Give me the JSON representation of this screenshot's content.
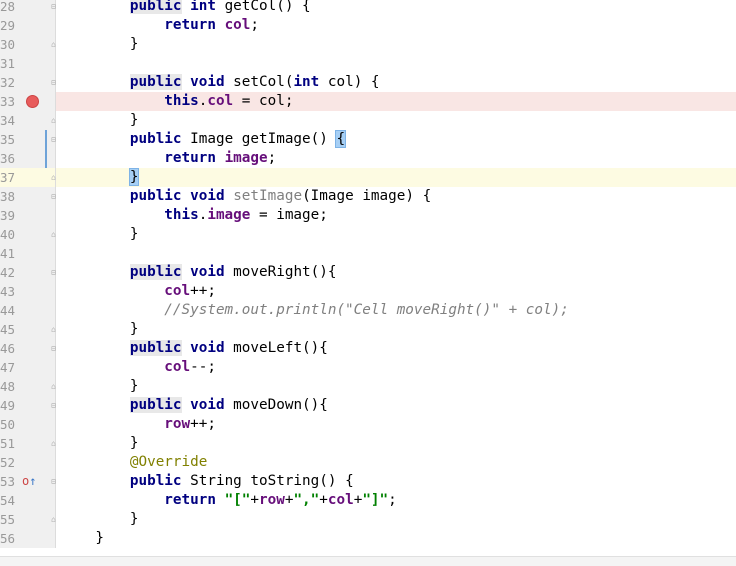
{
  "editor": {
    "lines": [
      {
        "n": "28",
        "html": "        <span class='kw kw-hl'>public</span> <span class='kw'>int</span> getCol() {"
      },
      {
        "n": "29",
        "html": "            <span class='kw'>return</span> <span class='fld'>col</span>;"
      },
      {
        "n": "30",
        "html": "        }"
      },
      {
        "n": "31",
        "html": ""
      },
      {
        "n": "32",
        "html": "        <span class='kw kw-hl'>public</span> <span class='kw'>void</span> setCol(<span class='kw'>int</span> col) {"
      },
      {
        "n": "33",
        "html": "            <span class='kw'>this</span>.<span class='fld'>col</span> = col;"
      },
      {
        "n": "34",
        "html": "        }"
      },
      {
        "n": "35",
        "html": "        <span class='kw'>public</span> Image getImage() <span class='brace-hl'>{</span>"
      },
      {
        "n": "36",
        "html": "            <span class='kw'>return</span> <span class='fld'>image</span>;"
      },
      {
        "n": "37",
        "html": "        <span class='brace-hl'>}</span>"
      },
      {
        "n": "38",
        "html": "        <span class='kw'>public</span> <span class='kw'>void</span> <span class='unused'>setImage</span>(Image image) {"
      },
      {
        "n": "39",
        "html": "            <span class='kw'>this</span>.<span class='fld'>image</span> = image;"
      },
      {
        "n": "40",
        "html": "        }"
      },
      {
        "n": "41",
        "html": ""
      },
      {
        "n": "42",
        "html": "        <span class='kw kw-hl'>public</span> <span class='kw'>void</span> moveRight(){"
      },
      {
        "n": "43",
        "html": "            <span class='fld'>col</span>++;"
      },
      {
        "n": "44",
        "html": "            <span class='cmt'>//System.out.println(\"Cell moveRight()\" + col);</span>"
      },
      {
        "n": "45",
        "html": "        }"
      },
      {
        "n": "46",
        "html": "        <span class='kw kw-hl'>public</span> <span class='kw'>void</span> moveLeft(){"
      },
      {
        "n": "47",
        "html": "            <span class='fld'>col</span>--;"
      },
      {
        "n": "48",
        "html": "        }"
      },
      {
        "n": "49",
        "html": "        <span class='kw kw-hl'>public</span> <span class='kw'>void</span> moveDown(){"
      },
      {
        "n": "50",
        "html": "            <span class='fld'>row</span>++;"
      },
      {
        "n": "51",
        "html": "        }"
      },
      {
        "n": "52",
        "html": "        <span class='ann'>@Override</span>"
      },
      {
        "n": "53",
        "html": "        <span class='kw'>public</span> String toString() {"
      },
      {
        "n": "54",
        "html": "            <span class='kw'>return</span> <span class='str'>\"[\"</span>+<span class='fld'>row</span>+<span class='str'>\",\"</span>+<span class='fld'>col</span>+<span class='str'>\"]\"</span>;"
      },
      {
        "n": "55",
        "html": "        }"
      },
      {
        "n": "56",
        "html": "    }"
      }
    ],
    "breakpoint_line": "33",
    "caret_line": "37",
    "override_line": "53",
    "override_icon": "override-method-icon"
  }
}
